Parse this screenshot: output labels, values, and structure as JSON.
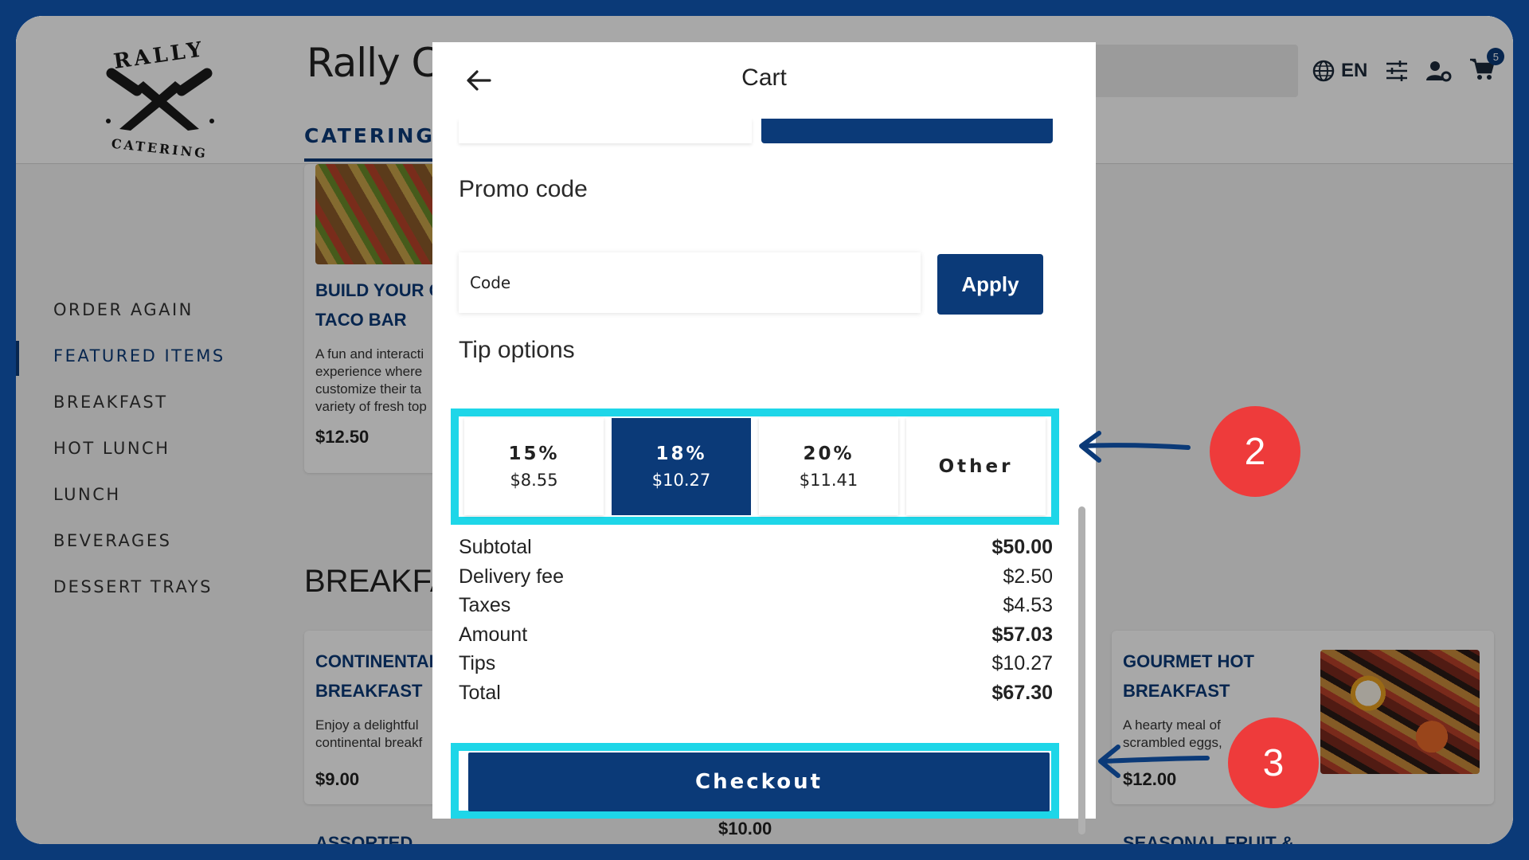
{
  "header": {
    "brand_title": "Rally Ca",
    "logo_top_text": "RALLY",
    "logo_bottom_text": "CATERING",
    "tab_catering": "CATERING",
    "language": "EN",
    "cart_count": "5"
  },
  "sidebar": {
    "items": [
      {
        "label": "ORDER AGAIN"
      },
      {
        "label": "FEATURED ITEMS"
      },
      {
        "label": "BREAKFAST"
      },
      {
        "label": "HOT LUNCH"
      },
      {
        "label": "LUNCH"
      },
      {
        "label": "BEVERAGES"
      },
      {
        "label": "DESSERT TRAYS"
      }
    ],
    "active_index": 1
  },
  "background_cards": {
    "taco": {
      "title_line1": "BUILD YOUR C",
      "title_line2": "TACO BAR",
      "desc": "A fun and interacti experience where customize their ta variety of fresh top",
      "price": "$12.50"
    },
    "section_breakfast": "BREAKFA",
    "continental": {
      "title_line1": "CONTINENTAL",
      "title_line2": "BREAKFAST",
      "desc": "Enjoy a delightful continental breakf",
      "price": "$9.00"
    },
    "gourmet": {
      "title_line1": "GOURMET HOT",
      "title_line2": "BREAKFAST",
      "desc": "A hearty meal of scrambled eggs,",
      "price": "$12.00"
    },
    "assorted_title": "ASSORTED",
    "middle_price": "$10.00",
    "seasonal_title": "SEASONAL FRUIT &"
  },
  "cart_modal": {
    "title": "Cart",
    "promo": {
      "heading": "Promo code",
      "placeholder": "Code",
      "apply_label": "Apply"
    },
    "tips": {
      "heading": "Tip options",
      "options": [
        {
          "pct": "15%",
          "amount": "$8.55"
        },
        {
          "pct": "18%",
          "amount": "$10.27"
        },
        {
          "pct": "20%",
          "amount": "$11.41"
        }
      ],
      "other_label": "Other",
      "selected_index": 1
    },
    "summary": [
      {
        "label": "Subtotal",
        "value": "$50.00"
      },
      {
        "label": "Delivery fee",
        "value": "$2.50"
      },
      {
        "label": "Taxes",
        "value": "$4.53"
      },
      {
        "label": "Amount",
        "value": "$57.03"
      },
      {
        "label": "Tips",
        "value": "$10.27"
      },
      {
        "label": "Total",
        "value": "$67.30"
      }
    ],
    "checkout_label": "Checkout"
  },
  "annotations": {
    "step_2": "2",
    "step_3": "3"
  },
  "colors": {
    "navy": "#0b3a78",
    "highlight": "#1ed6e8",
    "badge": "#ee3b3b"
  }
}
